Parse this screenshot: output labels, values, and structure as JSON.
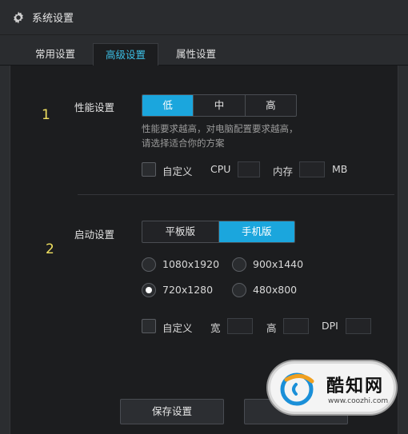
{
  "window": {
    "title": "系统设置",
    "icon": "gear-icon"
  },
  "tabs": [
    {
      "label": "常用设置",
      "active": false
    },
    {
      "label": "高级设置",
      "active": true
    },
    {
      "label": "属性设置",
      "active": false
    }
  ],
  "performance": {
    "marker": "1",
    "label": "性能设置",
    "options": [
      "低",
      "中",
      "高"
    ],
    "selected": "低",
    "hint_line1": "性能要求越高，对电脑配置要求越高，",
    "hint_line2": "请选择适合你的方案",
    "custom_label": "自定义",
    "cpu_label": "CPU",
    "cpu_value": "",
    "mem_label": "内存",
    "mem_value": "",
    "mem_unit": "MB"
  },
  "startup": {
    "marker": "2",
    "label": "启动设置",
    "options": [
      "平板版",
      "手机版"
    ],
    "selected": "手机版",
    "resolutions": [
      {
        "label": "1080x1920",
        "selected": false
      },
      {
        "label": "900x1440",
        "selected": false
      },
      {
        "label": "720x1280",
        "selected": true
      },
      {
        "label": "480x800",
        "selected": false
      }
    ],
    "custom_label": "自定义",
    "width_label": "宽",
    "width_value": "",
    "height_label": "高",
    "height_value": "",
    "dpi_label": "DPI",
    "dpi_value": ""
  },
  "buttons": {
    "save": "保存设置"
  },
  "watermark": {
    "name": "酷知网",
    "url": "www.coozhi.com"
  },
  "colors": {
    "accent": "#1ba6dd",
    "tab_active_text": "#3cc0e6",
    "marker": "#f0e060"
  }
}
